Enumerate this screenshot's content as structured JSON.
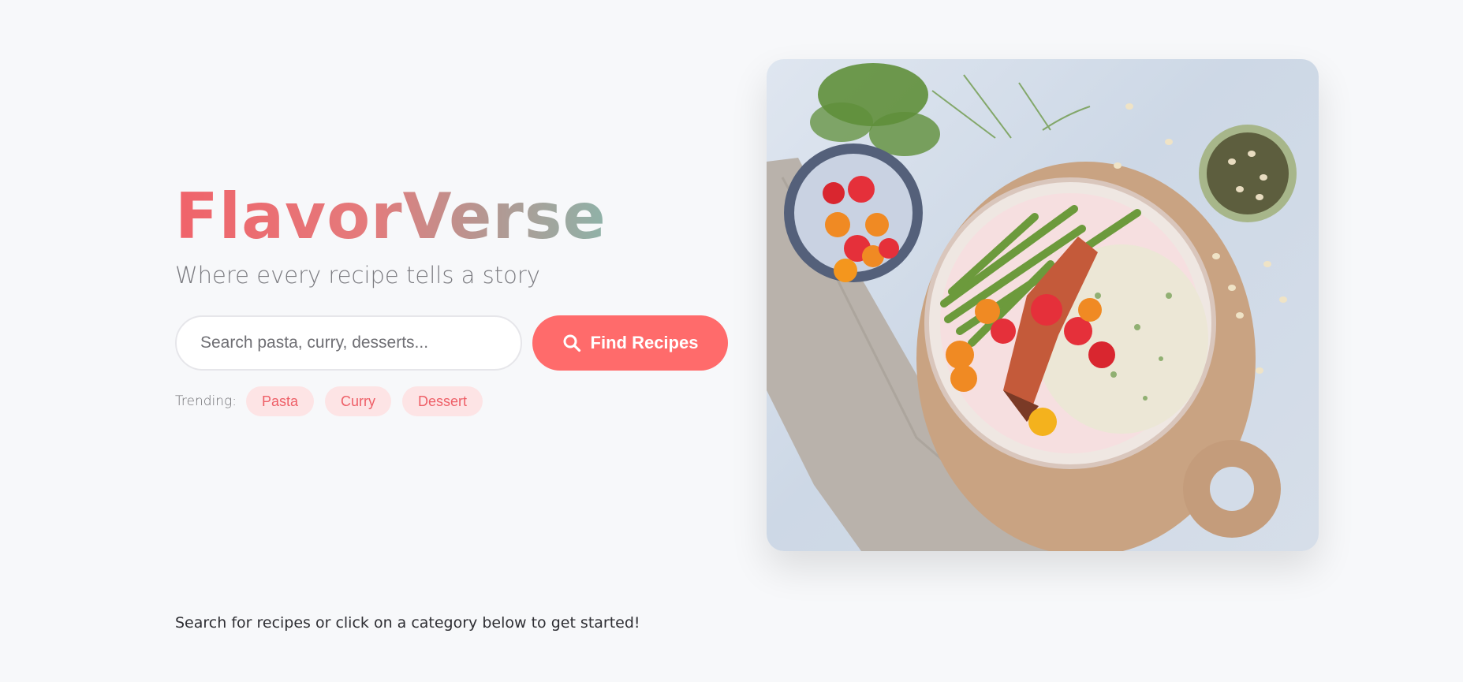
{
  "hero": {
    "brand": "FlavorVerse",
    "tagline": "Where every recipe tells a story"
  },
  "search": {
    "placeholder": "Search pasta, curry, desserts...",
    "value": "",
    "button_label": "Find Recipes",
    "button_icon": "search-icon"
  },
  "trending": {
    "label": "Trending:",
    "tags": [
      "Pasta",
      "Curry",
      "Dessert"
    ]
  },
  "hint": "Search for recipes or click on a category below to get started!",
  "colors": {
    "accent": "#ff6b6b",
    "chip_bg": "#fde4e5",
    "chip_text": "#ee5f67",
    "brand_gradient_start": "#f0636a",
    "brand_gradient_end": "#8fb2a8",
    "background": "#f7f8fa"
  }
}
